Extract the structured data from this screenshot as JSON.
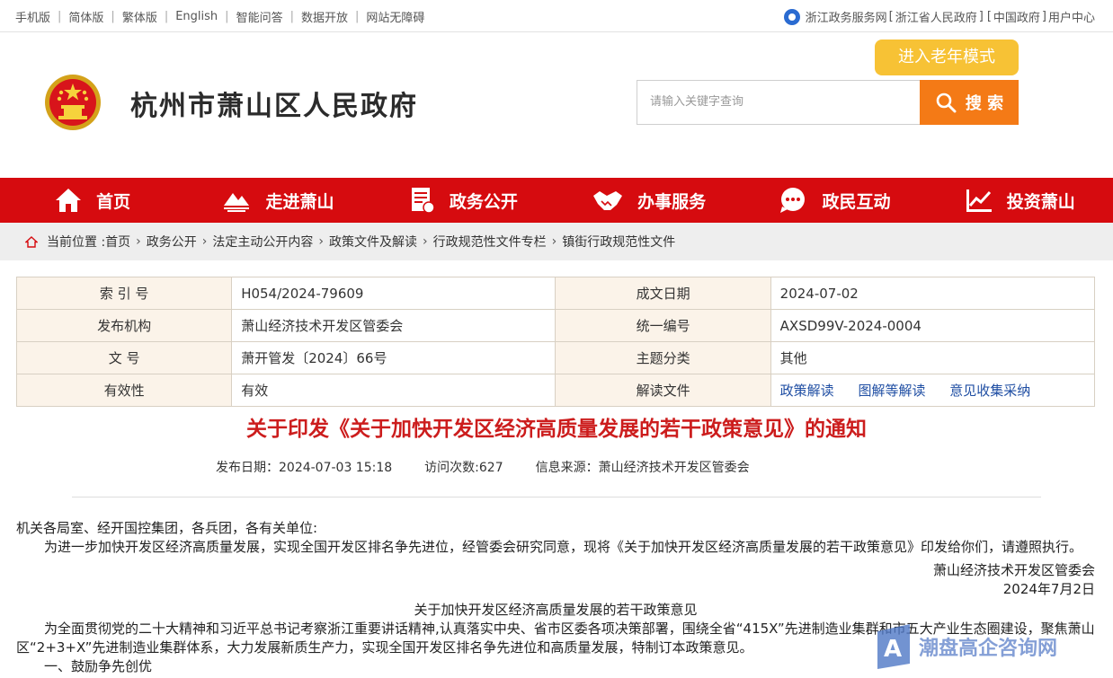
{
  "topbar": {
    "links": [
      "手机版",
      "简体版",
      "繁体版",
      "English",
      "智能问答",
      "数据开放",
      "网站无障碍"
    ],
    "right": {
      "portal": "浙江政务服务网",
      "province": "浙江省人民政府",
      "central": "中国政府",
      "user": "用户中心"
    }
  },
  "header": {
    "site_title": "杭州市萧山区人民政府",
    "elder_mode": "进入老年模式",
    "search_placeholder": "请输入关键字查询",
    "search_button": "搜 索"
  },
  "nav": [
    "首页",
    "走进萧山",
    "政务公开",
    "办事服务",
    "政民互动",
    "投资萧山"
  ],
  "breadcrumb": {
    "prefix": "当前位置 :",
    "items": [
      "首页",
      "政务公开",
      "法定主动公开内容",
      "政策文件及解读",
      "行政规范性文件专栏",
      "镇街行政规范性文件"
    ]
  },
  "info": {
    "rows": [
      {
        "k1": "索 引 号",
        "v1": "H054/2024-79609",
        "k2": "成文日期",
        "v2": "2024-07-02"
      },
      {
        "k1": "发布机构",
        "v1": "萧山经济技术开发区管委会",
        "k2": "统一编号",
        "v2": "AXSD99V-2024-0004"
      },
      {
        "k1": "文 号",
        "v1": "萧开管发〔2024〕66号",
        "k2": "主题分类",
        "v2": "其他"
      },
      {
        "k1": "有效性",
        "v1": "有效",
        "k2": "解读文件"
      }
    ],
    "links": [
      "政策解读",
      "图解等解读",
      "意见收集采纳"
    ]
  },
  "article": {
    "title": "关于印发《关于加快开发区经济高质量发展的若干政策意见》的通知",
    "publish_date": "发布日期：2024-07-03 15:18",
    "visits": "访问次数:627",
    "source": "信息来源：萧山经济技术开发区管委会",
    "salutation": "机关各局室、经开国控集团，各兵团，各有关单位:",
    "para1": "为进一步加快开发区经济高质量发展，实现全国开发区排名争先进位，经管委会研究同意，现将《关于加快开发区经济高质量发展的若干政策意见》印发给你们，请遵照执行。",
    "signer": "萧山经济技术开发区管委会",
    "sign_date": "2024年7月2日",
    "subtitle": "关于加快开发区经济高质量发展的若干政策意见",
    "para2": "为全面贯彻党的二十大精神和习近平总书记考察浙江重要讲话精神,认真落实中央、省市区委各项决策部署，围绕全省“415X”先进制造业集群和市五大产业生态圈建设，聚焦萧山区“2+3+X”先进制造业集群体系，大力发展新质生产力，实现全国开发区排名争先进位和高质量发展，特制订本政策意见。",
    "section1": "一、鼓励争先创优"
  },
  "watermark": "潮盘高企咨询网"
}
